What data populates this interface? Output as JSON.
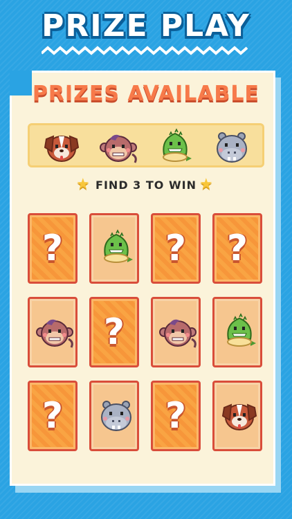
{
  "header": {
    "title": "PRIZE PLAY"
  },
  "panel": {
    "heading": "PRIZES AVAILABLE",
    "hint": "FIND 3 TO WIN",
    "prizes": [
      "dog",
      "monkey",
      "crocodile",
      "hippo"
    ]
  },
  "board": {
    "question_glyph": "?",
    "cards": [
      {
        "state": "hidden"
      },
      {
        "state": "revealed",
        "prize": "crocodile"
      },
      {
        "state": "hidden"
      },
      {
        "state": "hidden"
      },
      {
        "state": "revealed",
        "prize": "monkey"
      },
      {
        "state": "hidden"
      },
      {
        "state": "revealed",
        "prize": "monkey"
      },
      {
        "state": "revealed",
        "prize": "crocodile"
      },
      {
        "state": "hidden"
      },
      {
        "state": "revealed",
        "prize": "hippo"
      },
      {
        "state": "hidden"
      },
      {
        "state": "revealed",
        "prize": "dog"
      }
    ]
  },
  "colors": {
    "background": "#2aa3e3",
    "panel": "#fbf3da",
    "heading": "#f77a4a",
    "card": "#f9a443"
  }
}
